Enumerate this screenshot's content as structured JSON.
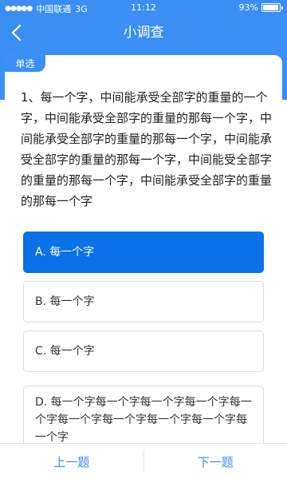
{
  "status_bar": {
    "signal_dots": "●●●●●",
    "carrier": "中国联通",
    "network": "3G",
    "time": "11:12",
    "battery_text": "93%",
    "battery_level": 0.93
  },
  "nav": {
    "back_icon": "chevron-left-icon",
    "title": "小调查"
  },
  "question": {
    "type_label": "单选",
    "text": "1、每一个字，中间能承受全部字的重量的一个字，中间能承受全部字的重量的那每一个字，中间能承受全部字的重量的那每一个字，中间能承受全部字的重量的那每一个字，中间能受全部字的重量的那每一个字，中间能承受全部字的重量的那每一个字",
    "options": [
      {
        "label": "A. 每一个字",
        "selected": true
      },
      {
        "label": "B. 每一个字",
        "selected": false
      },
      {
        "label": "C. 每一个字",
        "selected": false
      },
      {
        "label": "D. 每一个字每一个字每一个字每一个字每一个字每一个字每一个字每一个字每一个字每一个字",
        "selected": false
      }
    ]
  },
  "footer": {
    "prev_label": "上一题",
    "next_label": "下一题"
  },
  "colors": {
    "primary": "#3a8ef4",
    "selected": "#0a71e6",
    "border": "#dddddd"
  }
}
